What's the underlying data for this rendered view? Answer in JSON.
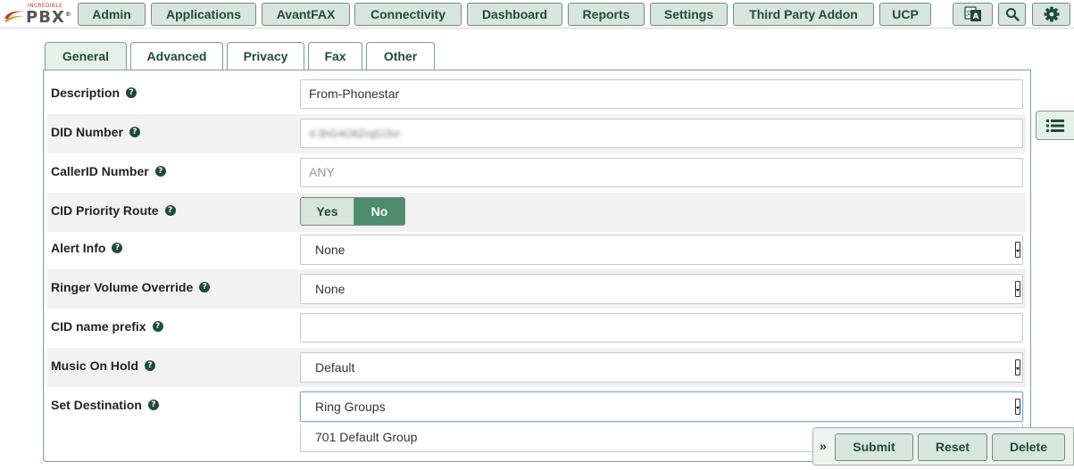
{
  "logo": {
    "small_text": "INCREDIBLE",
    "main_text": "PBX",
    "reg": "®"
  },
  "nav": {
    "items": [
      "Admin",
      "Applications",
      "AvantFAX",
      "Connectivity",
      "Dashboard",
      "Reports",
      "Settings",
      "Third Party Addon",
      "UCP"
    ],
    "icons": [
      "translate-icon",
      "search-icon",
      "gear-icon"
    ]
  },
  "tabs": [
    "General",
    "Advanced",
    "Privacy",
    "Fax",
    "Other"
  ],
  "active_tab": "General",
  "form": {
    "description": {
      "label": "Description",
      "value": "From-Phonestar"
    },
    "did_number": {
      "label": "DID Number",
      "value": "4:3hG4O8Zrq0J3vl"
    },
    "callerid_number": {
      "label": "CallerID Number",
      "placeholder": "ANY"
    },
    "cid_priority_route": {
      "label": "CID Priority Route",
      "yes_label": "Yes",
      "no_label": "No",
      "selected": "No"
    },
    "alert_info": {
      "label": "Alert Info",
      "value": "None"
    },
    "ringer_volume_override": {
      "label": "Ringer Volume Override",
      "value": "None"
    },
    "cid_name_prefix": {
      "label": "CID name prefix",
      "value": ""
    },
    "music_on_hold": {
      "label": "Music On Hold",
      "value": "Default"
    },
    "set_destination": {
      "label": "Set Destination",
      "value": "Ring Groups",
      "option": "701 Default Group"
    }
  },
  "help_glyph": "?",
  "actions": {
    "expand_glyph": "»",
    "submit": "Submit",
    "reset": "Reset",
    "delete": "Delete"
  },
  "colors": {
    "accent": "#4d8c6c",
    "button_bg": "#d8e4de",
    "button_text": "#1f4b3a",
    "border": "#7aa08f"
  }
}
